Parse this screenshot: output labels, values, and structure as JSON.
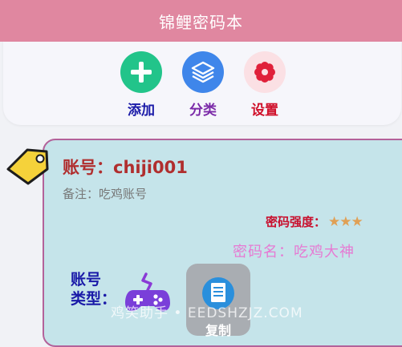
{
  "app": {
    "title": "锦鲤密码本"
  },
  "toolbar": {
    "items": [
      {
        "label": "添加",
        "icon": "plus-icon",
        "color": "#22c48a",
        "label_color": "#1a1aa8"
      },
      {
        "label": "分类",
        "icon": "layers-icon",
        "color": "#3f86ea",
        "label_color": "#7b2aa8"
      },
      {
        "label": "设置",
        "icon": "flower-gear-icon",
        "color": "#fbe0e4",
        "label_color": "#d0102a"
      }
    ]
  },
  "card": {
    "account_label": "账号：",
    "account_value": "chiji001",
    "remark_label": "备注：",
    "remark_value": "吃鸡账号",
    "strength_label": "密码强度：",
    "strength_rating": 3,
    "strength_max": 3,
    "pwname_label": "密码名：",
    "pwname_value": "吃鸡大神",
    "type_label_line1": "账号",
    "type_label_line2": "类型：",
    "type_icon": "gamepad-icon",
    "copy_label": "复制"
  },
  "watermark": "鸡笑助手 • EEDSHZJZ.COM"
}
